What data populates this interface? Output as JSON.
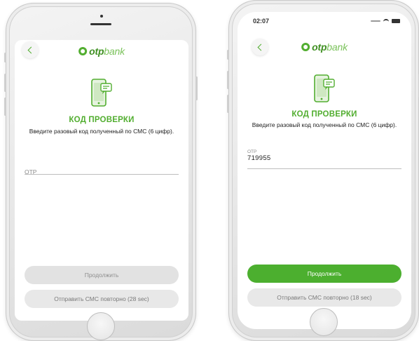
{
  "colors": {
    "brand_green": "#52ae30",
    "button_disabled": "#e2e2e2",
    "button_primary": "#4caf2f"
  },
  "icons": {
    "back": "chevron-left-icon",
    "logo": "otpbank-logo-icon",
    "sms": "phone-sms-icon",
    "signal": "signal-icon",
    "wifi": "wifi-icon",
    "battery": "battery-icon"
  },
  "left_screen": {
    "logo_otp": "otp",
    "logo_bank": "bank",
    "title": "КОД ПРОВЕРКИ",
    "subtitle": "Введите разовый код полученный по СМС (6 цифр).",
    "otp_placeholder": "OTP",
    "continue_label": "Продолжить",
    "continue_enabled": false,
    "resend_label": "Отправить СМС повторно (28 sec)"
  },
  "right_screen": {
    "status_time": "02:07",
    "logo_otp": "otp",
    "logo_bank": "bank",
    "title": "КОД ПРОВЕРКИ",
    "subtitle": "Введите разовый код полученный по СМС (6 цифр).",
    "otp_caption": "OTP",
    "otp_value": "719955",
    "continue_label": "Продолжить",
    "continue_enabled": true,
    "resend_label": "Отправить СМС повторно (18 sec)"
  }
}
